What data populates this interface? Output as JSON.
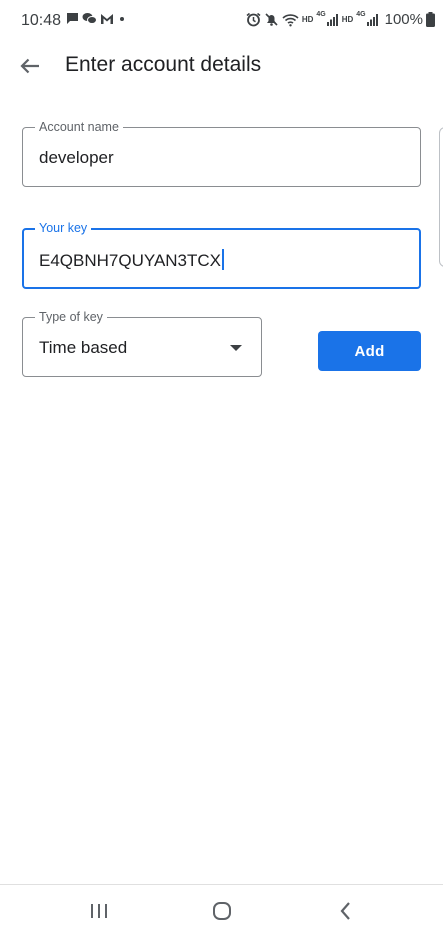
{
  "status_bar": {
    "time": "10:48",
    "hd1": "HD",
    "net1": "4G",
    "hd2": "HD",
    "net2": "4G",
    "battery": "100%",
    "notification_icons": [
      "chat-bubble-icon",
      "wechat-icon",
      "gmail-icon",
      "dot-icon"
    ],
    "system_icons": [
      "alarm-icon",
      "mute-icon",
      "wifi-icon",
      "signal-icon",
      "signal-icon",
      "battery-icon"
    ]
  },
  "header": {
    "title": "Enter account details",
    "back_icon": "arrow-back-icon"
  },
  "form": {
    "account_name": {
      "label": "Account name",
      "value": "developer"
    },
    "your_key": {
      "label": "Your key",
      "value": "E4QBNH7QUYAN3TCX"
    },
    "type_of_key": {
      "label": "Type of key",
      "value": "Time based"
    },
    "add_label": "Add"
  },
  "nav_bar": {
    "buttons": [
      "recents-icon",
      "home-icon",
      "back-icon"
    ]
  },
  "colors": {
    "accent": "#1a73e8",
    "text": "#202124",
    "secondary_text": "#5f6368",
    "border": "#8a8d91"
  }
}
